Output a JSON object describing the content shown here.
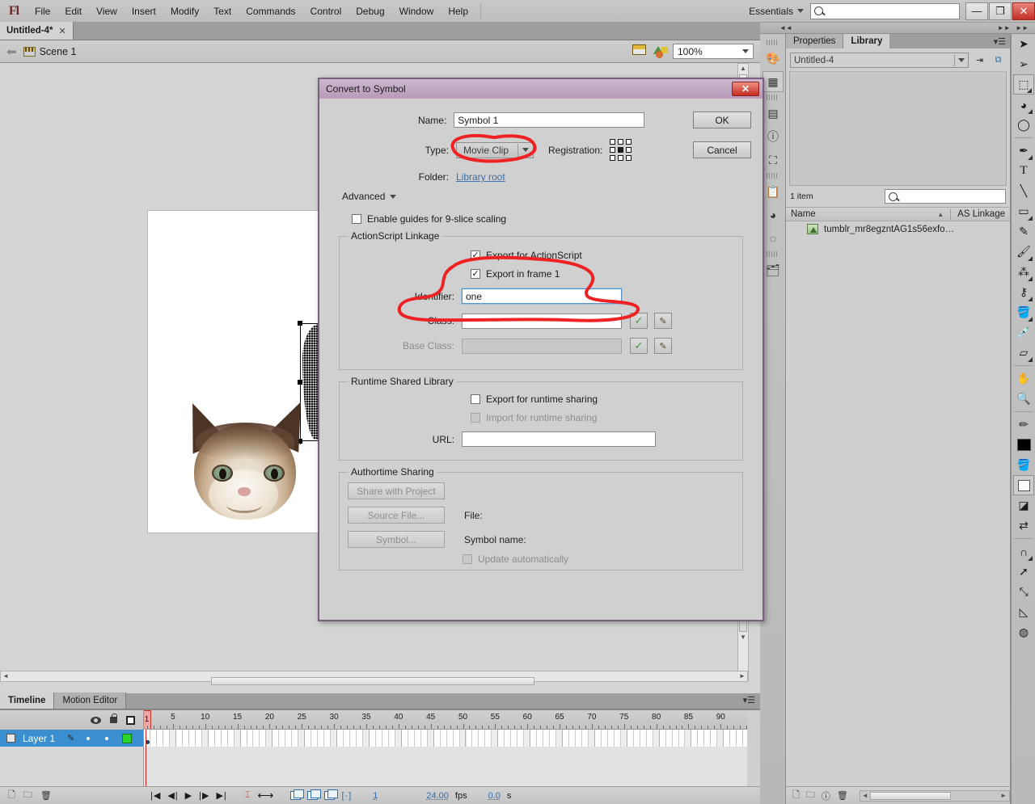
{
  "app": {
    "logo": "Fl",
    "menus": [
      "File",
      "Edit",
      "View",
      "Insert",
      "Modify",
      "Text",
      "Commands",
      "Control",
      "Debug",
      "Window",
      "Help"
    ],
    "workspace": "Essentials",
    "search_placeholder": "",
    "window_buttons": {
      "minimize": "—",
      "restore": "❐",
      "close": "✕"
    }
  },
  "document": {
    "tab_label": "Untitled-4*",
    "tab_close": "✕",
    "scene_label": "Scene 1",
    "zoom_level": "100%"
  },
  "timeline": {
    "tabs": [
      {
        "label": "Timeline",
        "active": true
      },
      {
        "label": "Motion Editor",
        "active": false
      }
    ],
    "ruler_numbers": [
      1,
      5,
      10,
      15,
      20,
      25,
      30,
      35,
      40,
      45,
      50,
      55,
      60,
      65,
      70,
      75,
      80,
      85,
      90
    ],
    "current_frame_marker": "1",
    "layers": [
      {
        "name": "Layer 1",
        "selected": true
      }
    ],
    "status": {
      "frame": "1",
      "fps": "24.00",
      "fps_unit": "fps",
      "elapsed": "0.0",
      "elapsed_unit": "s"
    }
  },
  "library": {
    "tabs": [
      {
        "label": "Properties",
        "active": false
      },
      {
        "label": "Library",
        "active": true
      }
    ],
    "document_selector": "Untitled-4",
    "item_count": "1 item",
    "search_placeholder": "",
    "columns": [
      "Name",
      "AS Linkage"
    ],
    "items": [
      {
        "name": "tumblr_mr8egzntAG1s56exfo…",
        "as_linkage": ""
      }
    ]
  },
  "dialog": {
    "title": "Convert to Symbol",
    "close_label": "✕",
    "name_label": "Name:",
    "name_value": "Symbol 1",
    "type_label": "Type:",
    "type_value": "Movie Clip",
    "registration_label": "Registration:",
    "folder_label": "Folder:",
    "folder_value": "Library root",
    "advanced_label": "Advanced",
    "ok_label": "OK",
    "cancel_label": "Cancel",
    "nine_slice_label": "Enable guides for 9-slice scaling",
    "nine_slice_checked": false,
    "as_linkage": {
      "group_title": "ActionScript Linkage",
      "export_as_label": "Export for ActionScript",
      "export_as_checked": true,
      "export_frame1_label": "Export in frame 1",
      "export_frame1_checked": true,
      "identifier_label": "Identifier:",
      "identifier_value": "one",
      "class_label": "Class:",
      "class_value": "",
      "base_class_label": "Base Class:",
      "base_class_value": ""
    },
    "runtime_shared": {
      "group_title": "Runtime Shared Library",
      "export_runtime_label": "Export for runtime sharing",
      "export_runtime_checked": false,
      "import_runtime_label": "Import for runtime sharing",
      "import_runtime_checked": false,
      "url_label": "URL:",
      "url_value": ""
    },
    "authortime": {
      "group_title": "Authortime Sharing",
      "share_project_label": "Share with Project",
      "source_file_label": "Source File...",
      "symbol_label": "Symbol...",
      "file_label": "File:",
      "symbol_name_label": "Symbol name:",
      "update_auto_label": "Update automatically",
      "update_auto_checked": false
    }
  },
  "annotations": {
    "color": "#ee2222",
    "marks": [
      {
        "name": "type-dropdown-circle"
      },
      {
        "name": "actionscript-linkage-circle"
      }
    ]
  },
  "tools": {
    "items": [
      "selection-tool",
      "subselection-tool",
      "free-transform-tool",
      "gradient-transform-tool",
      "lasso-tool",
      "pen-tool",
      "text-tool",
      "line-tool",
      "rectangle-tool",
      "pencil-tool",
      "brush-tool",
      "spray-brush-tool",
      "bone-tool",
      "paint-bucket-tool",
      "eyedropper-tool",
      "eraser-tool",
      "hand-tool",
      "zoom-tool"
    ]
  }
}
